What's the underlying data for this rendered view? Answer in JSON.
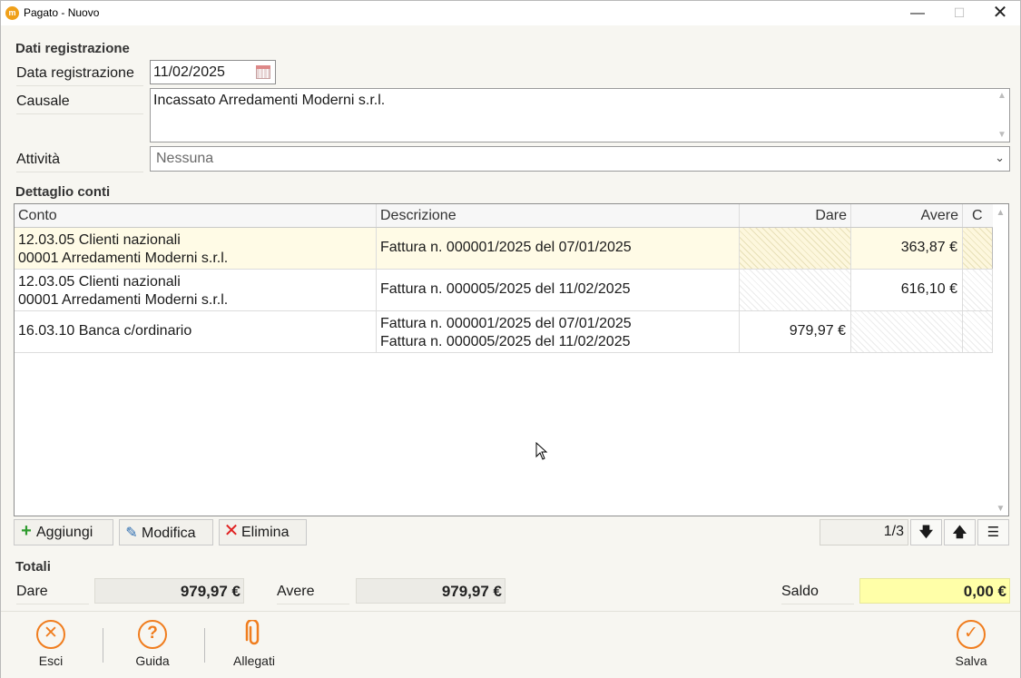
{
  "window": {
    "title": "Pagato - Nuovo",
    "app_icon": "m",
    "minimize_glyph": "—",
    "maximize_glyph": "☐",
    "close_glyph": "✕"
  },
  "registrazione": {
    "section_title": "Dati registrazione",
    "data_label": "Data registrazione",
    "data_value": "11/02/2025",
    "causale_label": "Causale",
    "causale_value": "Incassato Arredamenti Moderni s.r.l.",
    "attivita_label": "Attività",
    "attivita_value": "Nessuna"
  },
  "dettaglio": {
    "section_title": "Dettaglio conti",
    "columns": {
      "conto": "Conto",
      "descrizione": "Descrizione",
      "dare": "Dare",
      "avere": "Avere",
      "c": "C"
    },
    "rows": [
      {
        "conto_1": "12.03.05 Clienti nazionali",
        "conto_2": "00001 Arredamenti Moderni s.r.l.",
        "descr_1": "Fattura n. 000001/2025 del 07/01/2025",
        "descr_2": "",
        "dare": "",
        "avere": "363,87 €"
      },
      {
        "conto_1": "12.03.05 Clienti nazionali",
        "conto_2": "00001 Arredamenti Moderni s.r.l.",
        "descr_1": "Fattura n. 000005/2025 del 11/02/2025",
        "descr_2": "",
        "dare": "",
        "avere": "616,10 €"
      },
      {
        "conto_1": "16.03.10 Banca c/ordinario",
        "conto_2": "",
        "descr_1": "Fattura n. 000001/2025 del 07/01/2025",
        "descr_2": "Fattura n. 000005/2025 del 11/02/2025",
        "dare": "979,97 €",
        "avere": ""
      }
    ]
  },
  "toolbar": {
    "aggiungi": "Aggiungi",
    "modifica": "Modifica",
    "elimina": "Elimina",
    "pager": "1/3"
  },
  "totali": {
    "section_title": "Totali",
    "dare_label": "Dare",
    "dare_value": "979,97 €",
    "avere_label": "Avere",
    "avere_value": "979,97 €",
    "saldo_label": "Saldo",
    "saldo_value": "0,00 €"
  },
  "footer": {
    "esci": "Esci",
    "guida": "Guida",
    "allegati": "Allegati",
    "salva": "Salva"
  },
  "colors": {
    "accent": "#f07d1e",
    "selected_row": "#fffbe6",
    "saldo_bg": "#ffffa8"
  }
}
